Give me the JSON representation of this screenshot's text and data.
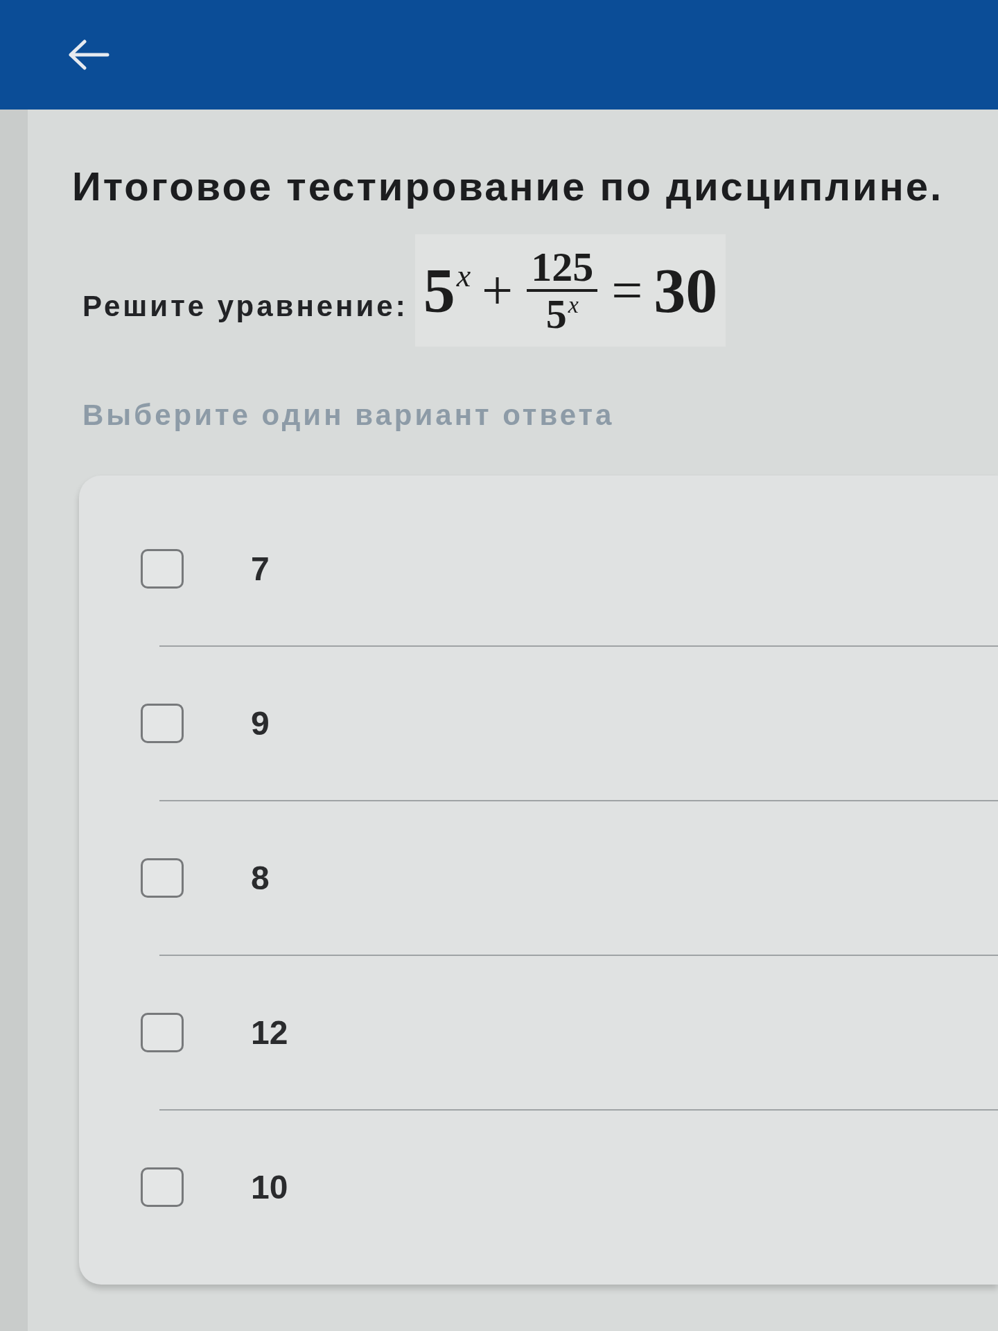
{
  "test_title": "Итоговое тестирование по дисциплине.",
  "question": {
    "prompt": "Решите уравнение:",
    "equation": [
      {
        "kind": "power",
        "base": "5",
        "exponent": "x"
      },
      {
        "kind": "operator",
        "text": "+"
      },
      {
        "kind": "fraction",
        "numerator": [
          {
            "kind": "number",
            "text": "125"
          }
        ],
        "denominator": [
          {
            "kind": "power",
            "base": "5",
            "exponent": "x"
          }
        ]
      },
      {
        "kind": "operator",
        "text": "="
      },
      {
        "kind": "number",
        "text": "30"
      }
    ],
    "instruction": "Выберите один вариант ответа",
    "options": [
      {
        "label": "7",
        "checked": false
      },
      {
        "label": "9",
        "checked": false
      },
      {
        "label": "8",
        "checked": false
      },
      {
        "label": "12",
        "checked": false
      },
      {
        "label": "10",
        "checked": false
      }
    ]
  }
}
